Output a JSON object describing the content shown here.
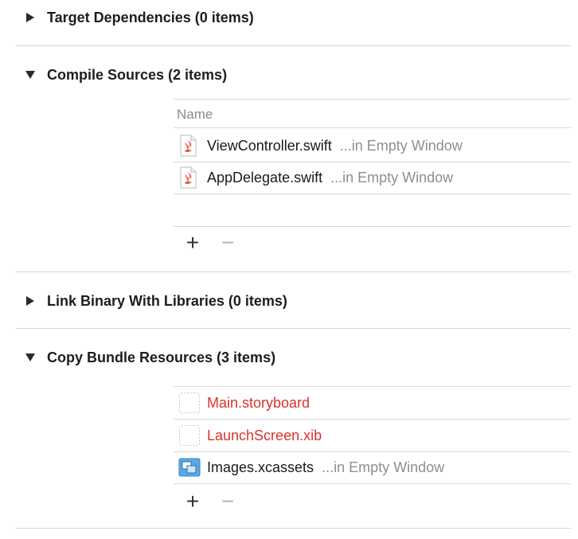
{
  "phases": {
    "target_dependencies": {
      "title": "Target Dependencies (0 items)",
      "expanded": false
    },
    "compile_sources": {
      "title": "Compile Sources (2 items)",
      "expanded": true,
      "column_header": "Name",
      "files": [
        {
          "name": "ViewController.swift",
          "location": "...in Empty Window",
          "icon": "swift-file-icon",
          "missing": false
        },
        {
          "name": "AppDelegate.swift",
          "location": "...in Empty Window",
          "icon": "swift-file-icon",
          "missing": false
        }
      ],
      "add_label": "+",
      "remove_label": "−"
    },
    "link_binary": {
      "title": "Link Binary With Libraries (0 items)",
      "expanded": false
    },
    "copy_bundle": {
      "title": "Copy Bundle Resources (3 items)",
      "expanded": true,
      "files": [
        {
          "name": "Main.storyboard",
          "location": "",
          "icon": "missing-file-icon",
          "missing": true
        },
        {
          "name": "LaunchScreen.xib",
          "location": "",
          "icon": "missing-file-icon",
          "missing": true
        },
        {
          "name": "Images.xcassets",
          "location": "...in Empty Window",
          "icon": "asset-catalog-icon",
          "missing": false
        }
      ],
      "add_label": "+",
      "remove_label": "−"
    }
  },
  "colors": {
    "missing_file": "#d9322b",
    "location_text": "#8e8e8e",
    "separator": "#d6d6d6"
  }
}
